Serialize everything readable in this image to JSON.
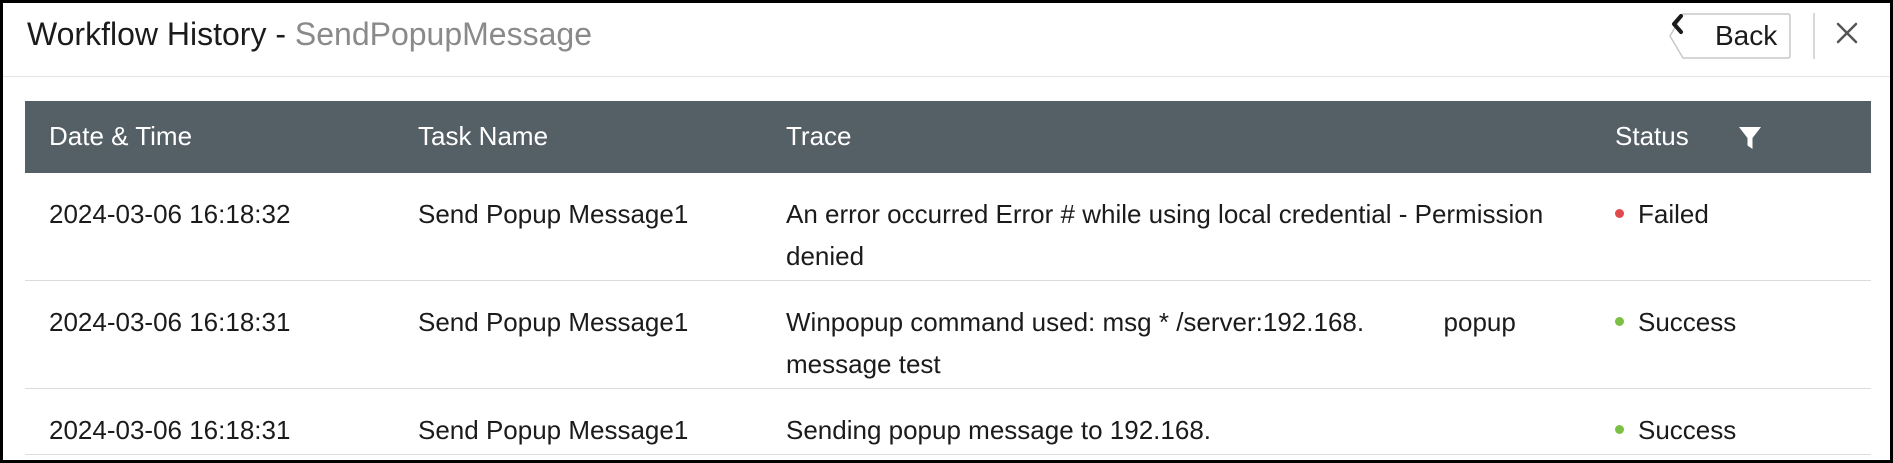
{
  "header": {
    "title": "Workflow History",
    "separator": " - ",
    "subtitle": "SendPopupMessage",
    "back_label": "Back",
    "back_icon": "chevron-left-icon",
    "close_icon": "close-icon"
  },
  "table": {
    "columns": [
      "Date & Time",
      "Task Name",
      "Trace",
      "Status"
    ],
    "filter_icon": "filter-icon",
    "rows": [
      {
        "datetime": "2024-03-06 16:18:32",
        "task": "Send Popup Message1",
        "trace": "An error occurred Error # while using local credential - Permission denied",
        "status": "Failed",
        "status_color": "#e04a4a"
      },
      {
        "datetime": "2024-03-06 16:18:31",
        "task": "Send Popup Message1",
        "trace": "Winpopup command used: msg * /server:192.168.           popup message test",
        "status": "Success",
        "status_color": "#7bc043"
      },
      {
        "datetime": "2024-03-06 16:18:31",
        "task": "Send Popup Message1",
        "trace": "Sending popup message to 192.168.",
        "status": "Success",
        "status_color": "#7bc043"
      }
    ]
  },
  "colors": {
    "header_bg": "#555f66",
    "header_text": "#ffffff",
    "subtitle_text": "#8a8a8a",
    "failed": "#e04a4a",
    "success": "#7bc043"
  }
}
